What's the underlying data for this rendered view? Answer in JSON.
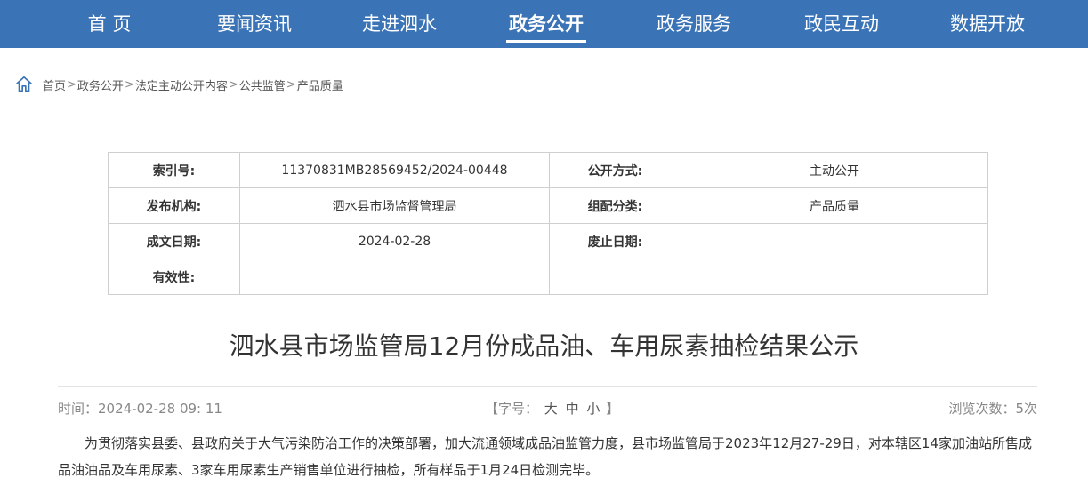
{
  "nav": {
    "items": [
      {
        "label": "首 页"
      },
      {
        "label": "要闻资讯"
      },
      {
        "label": "走进泗水"
      },
      {
        "label": "政务公开"
      },
      {
        "label": "政务服务"
      },
      {
        "label": "政民互动"
      },
      {
        "label": "数据开放"
      }
    ],
    "active": "政务公开"
  },
  "breadcrumb": {
    "items": [
      "首页",
      "政务公开",
      "法定主动公开内容",
      "公共监管",
      "产品质量"
    ],
    "separator": ">"
  },
  "meta": {
    "index_label": "索引号:",
    "index_value": "11370831MB28569452/2024-00448",
    "open_method_label": "公开方式:",
    "open_method_value": "主动公开",
    "publisher_label": "发布机构:",
    "publisher_value": "泗水县市场监督管理局",
    "category_label": "组配分类:",
    "category_value": "产品质量",
    "created_label": "成文日期:",
    "created_value": "2024-02-28",
    "abolish_label": "废止日期:",
    "abolish_value": "",
    "validity_label": "有效性:",
    "validity_value": ""
  },
  "article": {
    "title": "泗水县市场监管局12月份成品油、车用尿素抽检结果公示",
    "time": "时间：2024-02-28 09: 11",
    "fontsize_open": "【字号：",
    "fontsize_large": "大",
    "fontsize_medium": "中",
    "fontsize_small": "小",
    "fontsize_close": "】",
    "views": "浏览次数：5次",
    "paragraph": "为贯彻落实县委、县政府关于大气污染防治工作的决策部署，加大流通领域成品油监管力度，县市场监管局于2023年12月27-29日，对本辖区14家加油站所售成品油油品及车用尿素、3家车用尿素生产销售单位进行抽检，所有样品于1月24日检测完毕。"
  },
  "colors": {
    "nav_bg": "#3a73b6",
    "border": "#cfcfcf"
  }
}
